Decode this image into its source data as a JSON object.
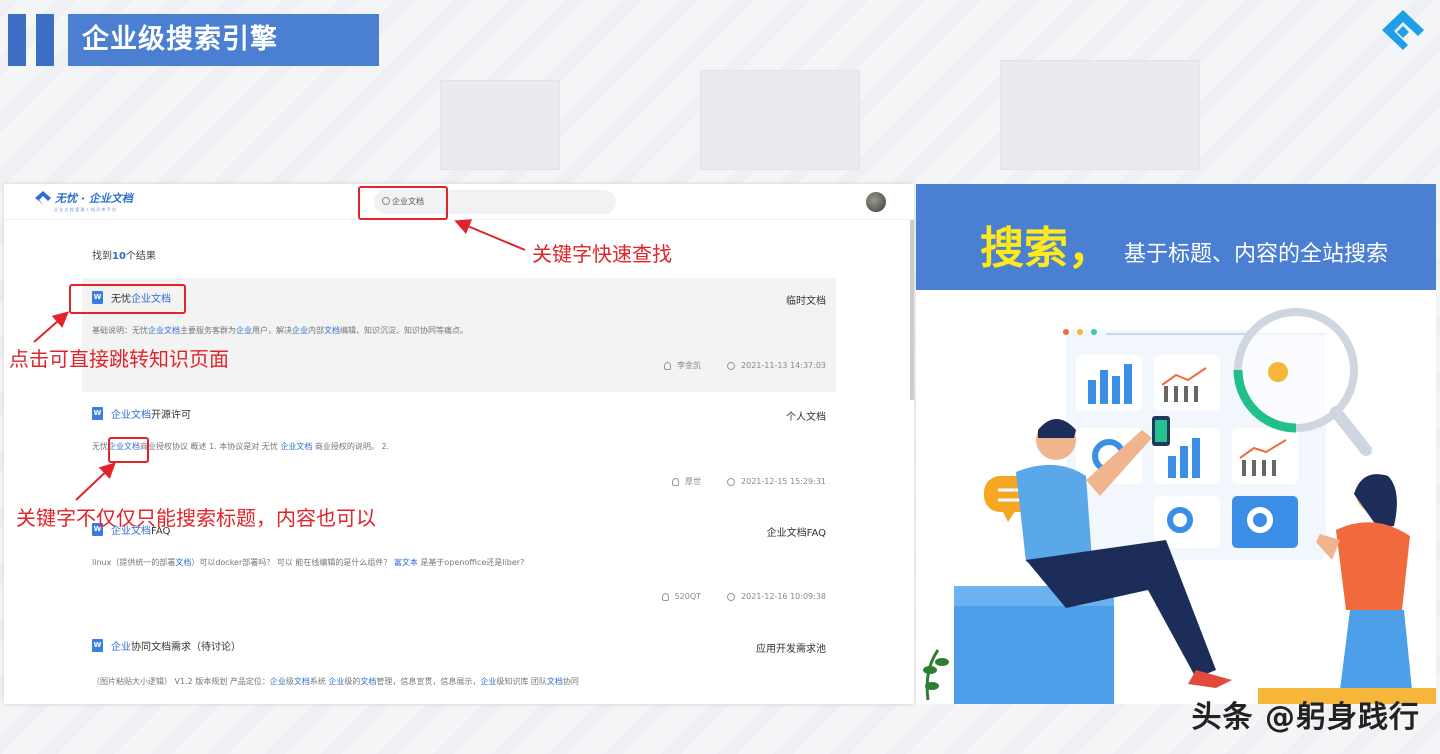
{
  "slide": {
    "title": "企业级搜索引擎",
    "watermark": "头条 @躬身践行"
  },
  "app": {
    "brand_name": "无忧 · 企业文档",
    "brand_sub": "企 业 文 档 管 理 ＋ 知 识 库 平 台",
    "search_value": "企业文档",
    "result_count_prefix": "找到",
    "result_count": "10",
    "result_count_suffix": "个结果"
  },
  "results": [
    {
      "title_pre": "无忧",
      "title_kw": "企业文档",
      "title_post": "",
      "category": "临时文档",
      "desc_parts": [
        "基础说明：无忧",
        "企业文档",
        "主要服务客群为",
        "企业",
        "用户，解决",
        "企业",
        "内部",
        "文档",
        "编辑、知识沉淀、知识协同等痛点。"
      ],
      "author": "李金凯",
      "time": "2021-11-13 14:37:03"
    },
    {
      "title_pre": "",
      "title_kw": "企业文档",
      "title_post": "开源许可",
      "category": "个人文档",
      "desc_parts": [
        "无忧",
        "企业文档",
        "商业授权协议 概述 1. 本协议是对 无忧 ",
        "企业文档",
        " 商业授权的说明。 2."
      ],
      "author": "厚世",
      "time": "2021-12-15 15:29:31"
    },
    {
      "title_pre": "",
      "title_kw": "企业文档",
      "title_post": "FAQ",
      "category": "企业文档FAQ",
      "desc_parts": [
        "linux（提供统一的部署",
        "文档",
        "）可以docker部署吗？ 可以 能在线编辑的是什么组件？ ",
        "富文本",
        " 是基于openoffice还是liber?"
      ],
      "author": "520QT",
      "time": "2021-12-16 10:09:38"
    },
    {
      "title_pre": "",
      "title_kw": "企业",
      "title_post": "协同文档需求（待讨论）",
      "category": "应用开发需求池",
      "desc_parts": [
        "（图片粘贴大小逻辑） V1.2 版本规划 产品定位：",
        "企业",
        "级",
        "文档",
        "系统 ",
        "企业",
        "级的",
        "文档",
        "管理，信息宣贯，信息展示，",
        "企业",
        "级知识库 团队",
        "文档",
        "协同"
      ],
      "author": "",
      "time": ""
    }
  ],
  "annotations": {
    "search": "关键字快速查找",
    "title": "点击可直接跳转知识页面",
    "content": "关键字不仅仅只能搜索标题，内容也可以"
  },
  "feature": {
    "headline": "搜索，",
    "subline": "基于标题、内容的全站搜索"
  },
  "colors": {
    "accent_blue": "#4a7fd1",
    "keyword_blue": "#2d6fd0",
    "annotation_red": "#e0242a",
    "headline_yellow": "#ffe91a"
  }
}
